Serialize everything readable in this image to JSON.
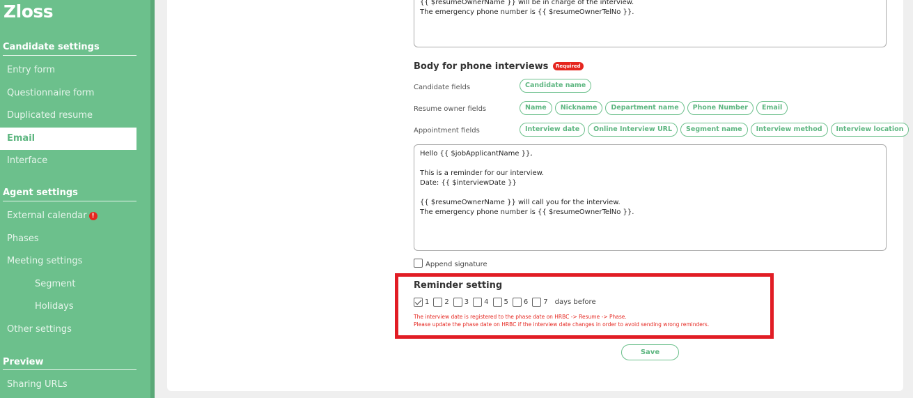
{
  "sidebar": {
    "brand": "Zloss",
    "sections": {
      "candidate": {
        "title": "Candidate settings",
        "items": [
          "Entry form",
          "Questionnaire form",
          "Duplicated resume",
          "Email",
          "Interface"
        ],
        "active": "Email"
      },
      "agent": {
        "title": "Agent settings",
        "items": [
          "External calendar",
          "Phases",
          "Meeting settings",
          "Segment",
          "Holidays",
          "Other settings"
        ],
        "alert_badge": "!"
      },
      "preview": {
        "title": "Preview",
        "items": [
          "Sharing URLs"
        ]
      }
    }
  },
  "email_form": {
    "previous_body_tail": "{{ $resumeOwnerName }} will be in charge of the interview.\nThe emergency phone number is {{ $resumeOwnerTelNo }}.",
    "phone_section": {
      "title": "Body for phone interviews",
      "required_badge": "Required",
      "candidate_fields_label": "Candidate fields",
      "candidate_fields": [
        "Candidate name"
      ],
      "resume_owner_fields_label": "Resume owner fields",
      "resume_owner_fields": [
        "Name",
        "Nickname",
        "Department name",
        "Phone Number",
        "Email"
      ],
      "appointment_fields_label": "Appointment fields",
      "appointment_fields": [
        "Interview date",
        "Online Interview URL",
        "Segment name",
        "Interview method",
        "Interview location"
      ],
      "body": "Hello {{ $jobApplicantName }},\n\nThis is a reminder for our interview.\nDate: {{ $interviewDate }}\n\n{{ $resumeOwnerName }} will call you for the interview.\nThe emergency phone number is {{ $resumeOwnerTelNo }}."
    },
    "append_signature_label": "Append signature",
    "append_signature_checked": false,
    "reminder": {
      "title": "Reminder setting",
      "days": [
        "1",
        "2",
        "3",
        "4",
        "5",
        "6",
        "7"
      ],
      "checked": [
        "1"
      ],
      "suffix": "days before",
      "note_line1": "The interview date is registered to the phase date on HRBC -> Resume -> Phase.",
      "note_line2": "Please update the phase date on HRBC if the interview date changes in order to avoid sending wrong reminders."
    },
    "save_label": "Save"
  },
  "colors": {
    "sidebar_green": "#6cc08c",
    "accent_green": "#5db680",
    "required_red": "#e5261f",
    "highlight_red": "#e11d25"
  }
}
